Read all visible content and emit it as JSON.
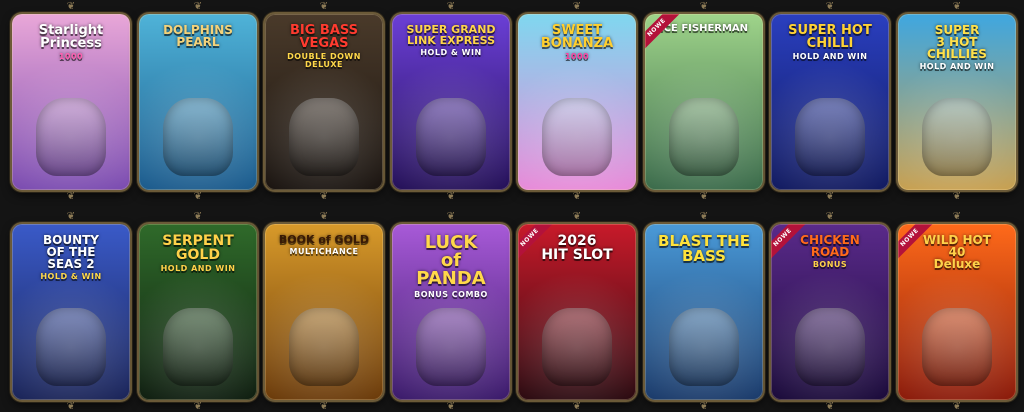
{
  "games": [
    {
      "title": "Starlight\nPrincess",
      "sub": "1000",
      "bg1": "#e9a7d8",
      "bg2": "#7a4bb0",
      "color": "#ffffff",
      "subcolor": "#ff5fb0",
      "new": false
    },
    {
      "title": "DOLPHINS\nPEARL",
      "sub": "",
      "bg1": "#4fb3d8",
      "bg2": "#1b5a8c",
      "color": "#f3d27a",
      "subcolor": "#ffffff",
      "new": false
    },
    {
      "title": "BIG BASS\nVEGAS",
      "sub": "DOUBLE DOWN DELUXE",
      "bg1": "#4a3a2a",
      "bg2": "#1a1410",
      "color": "#ff3b2f",
      "subcolor": "#ffd84a",
      "new": false
    },
    {
      "title": "SUPER GRAND\nLINK EXPRESS",
      "sub": "HOLD & WIN",
      "bg1": "#6b3fd6",
      "bg2": "#241058",
      "color": "#ffd54a",
      "subcolor": "#ffffff",
      "new": false
    },
    {
      "title": "SWEET\nBONANZA",
      "sub": "1000",
      "bg1": "#7fd7ef",
      "bg2": "#e88ad8",
      "color": "#ffcf2e",
      "subcolor": "#ff3fa0",
      "new": false
    },
    {
      "title": "ICE FISHERMAN",
      "sub": "",
      "bg1": "#9fd48a",
      "bg2": "#3a6a4a",
      "color": "#ffffff",
      "subcolor": "#ffffff",
      "new": true
    },
    {
      "title": "SUPER HOT\nCHILLI",
      "sub": "HOLD AND WIN",
      "bg1": "#2a3fbf",
      "bg2": "#111a60",
      "color": "#ffd234",
      "subcolor": "#ffffff",
      "new": false
    },
    {
      "title": "SUPER\n3 HOT\nCHILLIES",
      "sub": "HOLD AND WIN",
      "bg1": "#3fa7e0",
      "bg2": "#c8a050",
      "color": "#ffe04a",
      "subcolor": "#ffffff",
      "new": false
    },
    {
      "title": "BOUNTY\nOF THE\nSEAS 2",
      "sub": "HOLD & WIN",
      "bg1": "#3a5ac8",
      "bg2": "#1a2458",
      "color": "#ffffff",
      "subcolor": "#ffd84a",
      "new": false
    },
    {
      "title": "SERPENT\nGOLD",
      "sub": "HOLD AND WIN",
      "bg1": "#2f6a2a",
      "bg2": "#0f1e10",
      "color": "#ffd24a",
      "subcolor": "#ffd24a",
      "new": false
    },
    {
      "title": "BOOK of GOLD",
      "sub": "MULTICHANCE",
      "bg1": "#d89a2a",
      "bg2": "#6a3a0a",
      "color": "#3a1a05",
      "subcolor": "#ffffff",
      "new": false
    },
    {
      "title": "LUCK\nof\nPANDA",
      "sub": "BONUS COMBO",
      "bg1": "#a85ad8",
      "bg2": "#3a1a6a",
      "color": "#ffd84a",
      "subcolor": "#ffffff",
      "new": false
    },
    {
      "title": "2026\nHIT SLOT",
      "sub": "",
      "bg1": "#c81a2a",
      "bg2": "#2a0a10",
      "color": "#ffffff",
      "subcolor": "#ffd24a",
      "new": true
    },
    {
      "title": "BLAST THE\nBASS",
      "sub": "",
      "bg1": "#4a9ad8",
      "bg2": "#1a3a6a",
      "color": "#ffe23a",
      "subcolor": "#ffffff",
      "new": false
    },
    {
      "title": "CHICKEN\nROAD",
      "sub": "BONUS",
      "bg1": "#5a2a8a",
      "bg2": "#1a0a3a",
      "color": "#ff6a1a",
      "subcolor": "#ffd24a",
      "new": true
    },
    {
      "title": "WILD HOT\n40\nDeluxe",
      "sub": "",
      "bg1": "#ff6a1a",
      "bg2": "#8a1a0a",
      "color": "#ffd24a",
      "subcolor": "#ffffff",
      "new": true
    }
  ],
  "new_badge": "NOWE"
}
